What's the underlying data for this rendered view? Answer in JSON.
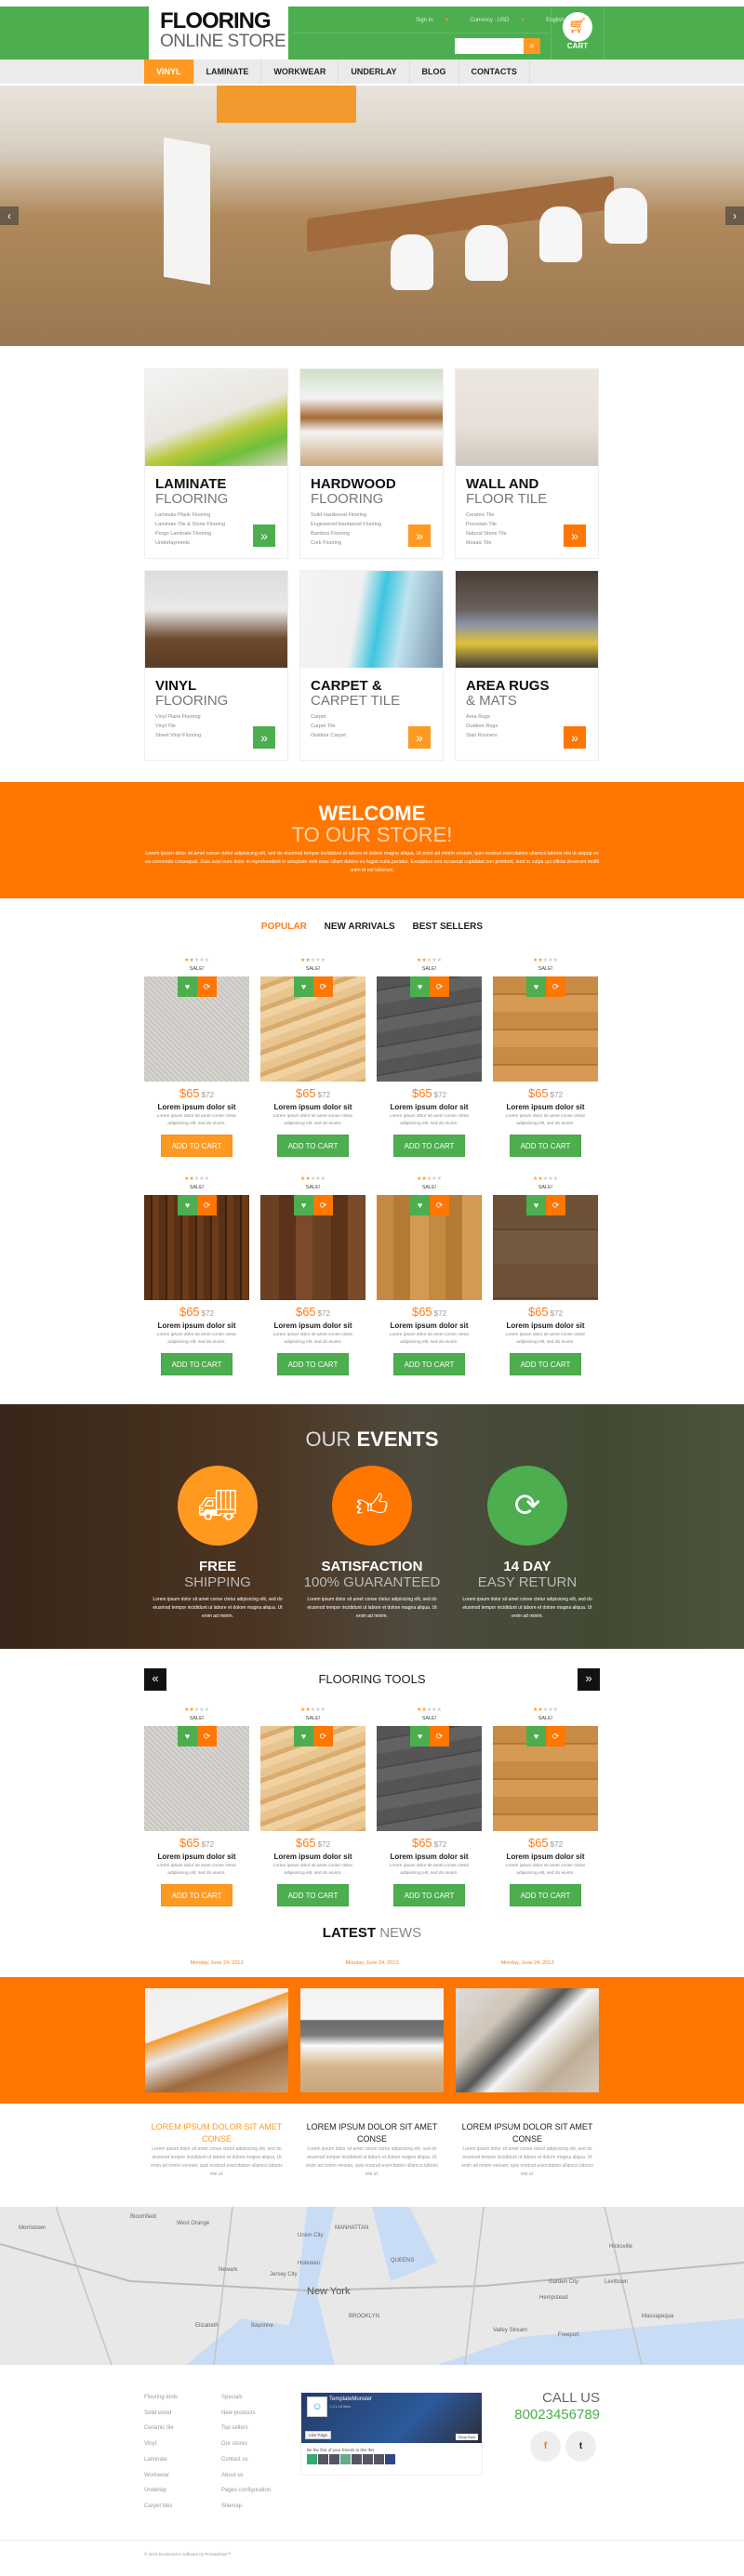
{
  "header": {
    "logo_top": "FLOORING",
    "logo_bottom": "ONLINE STORE",
    "links": [
      {
        "label": "Sign In"
      },
      {
        "label": "Currency : USD"
      },
      {
        "label": "English"
      }
    ],
    "search_placeholder": "",
    "cart_label": "CART",
    "colors": {
      "green": "#4cae4f",
      "orange": "#ff7600",
      "light_orange": "#ff9920"
    }
  },
  "nav": {
    "items": [
      "VINYL",
      "LAMINATE",
      "WORKWEAR",
      "UNDERLAY",
      "BLOG",
      "CONTACTS"
    ],
    "active": "VINYL"
  },
  "hero": {
    "prev": "‹",
    "next": "›"
  },
  "categories": [
    {
      "title": "LAMINATE",
      "subtitle": "FLOORING",
      "items": [
        "Laminate Plank Flooring",
        "Laminate Tile & Stone Flooring",
        "Pergo Laminate Flooring",
        "Underlayments"
      ],
      "button_color": "green"
    },
    {
      "title": "HARDWOOD",
      "subtitle": "FLOORING",
      "items": [
        "Solid Hardwood Flooring",
        "Engineered Hardwood Flooring",
        "Bamboo Flooring",
        "Cork Flooring"
      ],
      "button_color": "light-orange"
    },
    {
      "title": "WALL AND",
      "subtitle": "FLOOR TILE",
      "items": [
        "Ceramic Tile",
        "Porcelain Tile",
        "Natural Stone Tile",
        "Mosaic Tile"
      ],
      "button_color": "orange"
    },
    {
      "title": "VINYL",
      "subtitle": "FLOORING",
      "items": [
        "Vinyl Plank Flooring",
        "Vinyl Tile",
        "Sheet Vinyl Flooring"
      ],
      "button_color": "green"
    },
    {
      "title": "CARPET &",
      "subtitle": "CARPET TILE",
      "items": [
        "Carpet",
        "Carpet Tile",
        "Outdoor Carpet"
      ],
      "button_color": "light-orange"
    },
    {
      "title": "AREA RUGS",
      "subtitle": "& MATS",
      "items": [
        "Area Rugs",
        "Outdoor Rugs",
        "Stair Runners"
      ],
      "button_color": "orange"
    }
  ],
  "welcome": {
    "title": "WELCOME",
    "subtitle": "TO OUR STORE!",
    "body": "Lorem ipsum dolor sit amet conse ctetur adipisicing elit, sed do eiusmod tempor incididunt ut labore et dolore magna aliqua. Ut enim ad minim veniam, quis nostrud exercitation ullamco laboris nisi ut aliquip ex ea commodo consequat. Duis aute irure dolor in reprehenderit in voluptate velit esse cillum dolore eu fugiat nulla pariatur. Excepteur sint occaecat cupidatat non proident, sunt in culpa qui officia deserunt mollit anim id est laborum."
  },
  "product_tabs": [
    "POPULAR",
    "NEW ARRIVALS",
    "BEST SELLERS"
  ],
  "product_tabs_active": "POPULAR",
  "product_common": {
    "rating": 2,
    "rating_max": 5,
    "sale": "SALE!",
    "price": "$65",
    "old_price": "$72",
    "name": "Lorem ipsum dolor sit",
    "desc": "Lorem ipsum dolor sit amet conse ctetur adipisicing elit, sed do eiusm.",
    "add_to_cart": "ADD TO CART"
  },
  "products": [
    {
      "texture": "carpet",
      "cart_highlight": true
    },
    {
      "texture": "light-wood",
      "cart_highlight": false
    },
    {
      "texture": "dark-grey-wood",
      "cart_highlight": false
    },
    {
      "texture": "honey-wood",
      "cart_highlight": false
    },
    {
      "texture": "dark-oak",
      "cart_highlight": false
    },
    {
      "texture": "walnut",
      "cart_highlight": false
    },
    {
      "texture": "golden-oak",
      "cart_highlight": false
    },
    {
      "texture": "brown-oak",
      "cart_highlight": false
    }
  ],
  "events": {
    "title_thin": "OUR",
    "title_bold": "EVENTS",
    "items": [
      {
        "icon": "truck-icon",
        "title": "FREE",
        "subtitle": "SHIPPING",
        "body": "Lorem ipsum dolor sit amet conse ctetur adipisicing elit, sed do eiusmod tempor incididunt ut labore et dolore magna aliqua. Ut enim ad minim."
      },
      {
        "icon": "thumbs-up-icon",
        "title": "SATISFACTION",
        "subtitle": "100% GUARANTEED",
        "body": "Lorem ipsum dolor sit amet conse ctetur adipisicing elit, sed do eiusmod tempor incididunt ut labore et dolore magna aliqua. Ut enim ad minim."
      },
      {
        "icon": "refresh-icon",
        "title": "14 DAY",
        "subtitle": "EASY RETURN",
        "body": "Lorem ipsum dolor sit amet conse ctetur adipisicing elit, sed do eiusmod tempor incididunt ut labore et dolore magna aliqua. Ut enim ad minim."
      }
    ]
  },
  "tools": {
    "title": "FLOORING TOOLS",
    "prev": "«",
    "next": "»",
    "products": [
      {
        "texture": "carpet",
        "cart_highlight": true
      },
      {
        "texture": "light-wood",
        "cart_highlight": false
      },
      {
        "texture": "dark-grey-wood",
        "cart_highlight": false
      },
      {
        "texture": "honey-wood",
        "cart_highlight": false
      }
    ]
  },
  "news": {
    "title_bold": "LATEST",
    "title_thin": "NEWS",
    "items": [
      {
        "date": "Monday, June 24, 2013",
        "title": "LOREM IPSUM DOLOR SIT AMET CONSE",
        "highlight": true,
        "body": "Lorem ipsum dolor sit amet conse ctetur adipisicing elit, sed do eiusmod tempor incididunt ut labore et dolore magna aliqua. Ut enim ad minim veniam, quis nostrud exercitation ullamco laboris nisi ut."
      },
      {
        "date": "Monday, June 24, 2013",
        "title": "LOREM IPSUM DOLOR SIT AMET CONSE",
        "highlight": false,
        "body": "Lorem ipsum dolor sit amet conse ctetur adipisicing elit, sed do eiusmod tempor incididunt ut labore et dolore magna aliqua. Ut enim ad minim veniam, quis nostrud exercitation ullamco laboris nisi ut."
      },
      {
        "date": "Monday, June 24, 2013",
        "title": "LOREM IPSUM DOLOR SIT AMET CONSE",
        "highlight": false,
        "body": "Lorem ipsum dolor sit amet conse ctetur adipisicing elit, sed do eiusmod tempor incididunt ut labore et dolore magna aliqua. Ut enim ad minim veniam, quis nostrud exercitation ullamco laboris nisi ut."
      }
    ]
  },
  "map": {
    "labels": [
      "Morristown",
      "Bloomfield",
      "West Orange",
      "Newark",
      "Jersey City",
      "New York",
      "MANHATTAN",
      "QUEENS",
      "BROOKLYN",
      "Elizabeth",
      "Bayonne",
      "Hempstead",
      "Levittown",
      "Hicksville",
      "Union City",
      "Hoboken",
      "Garden City",
      "Valley Stream",
      "Freeport",
      "Massapequa"
    ]
  },
  "footer": {
    "col1": [
      "Flooring tools",
      "Solid wood",
      "Ceramic tile",
      "Vinyl",
      "Laminate",
      "Workwear",
      "Underlay",
      "Carpet tiles"
    ],
    "col2": [
      "Specials",
      "New products",
      "Top sellers",
      "Our stores",
      "Contact us",
      "About us",
      "Pages configuration",
      "Sitemap"
    ],
    "facebook": {
      "page_name": "TemplateMonster",
      "likes": "7,C1.18 likes",
      "like_button": "Like Page",
      "shop_button": "Shop Now",
      "friends_text": "Be the first of your friends to like this"
    },
    "call_us": "CALL US",
    "phone": "80023456789",
    "social": [
      {
        "icon": "facebook-icon",
        "glyph": "f"
      },
      {
        "icon": "twitter-icon",
        "glyph": "t"
      }
    ],
    "copyright": "© 2015 Ecommerce software by PrestaShop™"
  }
}
